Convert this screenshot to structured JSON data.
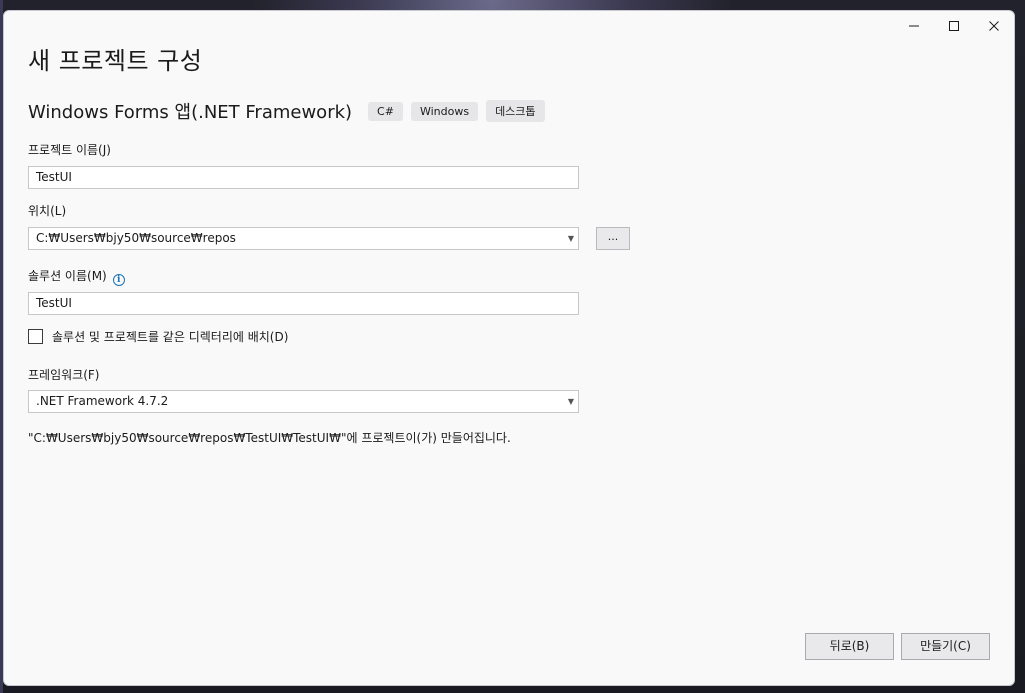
{
  "dialog": {
    "title": "새 프로젝트 구성",
    "controls": {
      "minimize_icon": "minimize-icon",
      "maximize_icon": "maximize-icon",
      "close_icon": "close-icon"
    }
  },
  "template": {
    "name": "Windows Forms 앱(.NET Framework)",
    "tags": [
      "C#",
      "Windows",
      "데스크톱"
    ]
  },
  "project_name": {
    "label": "프로젝트 이름(J)",
    "value": "TestUI"
  },
  "location": {
    "label": "위치(L)",
    "value": "C:₩Users₩bjy50₩source₩repos",
    "browse_label": "..."
  },
  "solution_name": {
    "label": "솔루션 이름(M)",
    "value": "TestUI",
    "info_icon": "info-icon"
  },
  "same_directory": {
    "label": "솔루션 및 프로젝트를 같은 디렉터리에 배치(D)",
    "checked": false
  },
  "framework": {
    "label": "프레임워크(F)",
    "value": ".NET Framework 4.7.2"
  },
  "path_note": "\"C:₩Users₩bjy50₩source₩repos₩TestUI₩TestUI₩\"에 프로젝트이(가) 만들어집니다.",
  "footer": {
    "back_label": "뒤로(B)",
    "create_label": "만들기(C)"
  },
  "colors": {
    "dialog_bg": "#f9f9fa",
    "info_blue": "#1a73b8"
  }
}
